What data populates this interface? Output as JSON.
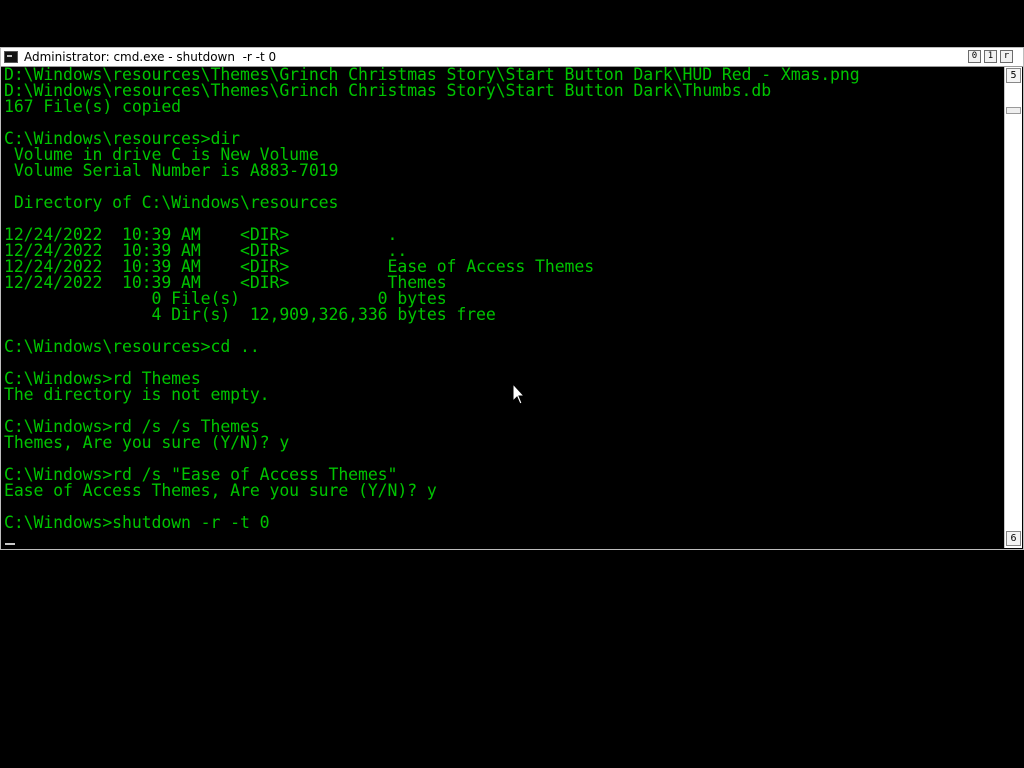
{
  "window": {
    "title": "Administrator: cmd.exe - shutdown  -r -t 0",
    "controls": {
      "minimize": "0",
      "maximize": "1",
      "close": "r"
    }
  },
  "terminal": {
    "lines": [
      "D:\\Windows\\resources\\Themes\\Grinch Christmas Story\\Start Button Dark\\HUD Red - Xmas.png",
      "D:\\Windows\\resources\\Themes\\Grinch Christmas Story\\Start Button Dark\\Thumbs.db",
      "167 File(s) copied",
      "",
      "C:\\Windows\\resources>dir",
      " Volume in drive C is New Volume",
      " Volume Serial Number is A883-7019",
      "",
      " Directory of C:\\Windows\\resources",
      "",
      "12/24/2022  10:39 AM    <DIR>          .",
      "12/24/2022  10:39 AM    <DIR>          ..",
      "12/24/2022  10:39 AM    <DIR>          Ease of Access Themes",
      "12/24/2022  10:39 AM    <DIR>          Themes",
      "               0 File(s)              0 bytes",
      "               4 Dir(s)  12,909,326,336 bytes free",
      "",
      "C:\\Windows\\resources>cd ..",
      "",
      "C:\\Windows>rd Themes",
      "The directory is not empty.",
      "",
      "C:\\Windows>rd /s /s Themes",
      "Themes, Are you sure (Y/N)? y",
      "",
      "C:\\Windows>rd /s \"Ease of Access Themes\"",
      "Ease of Access Themes, Are you sure (Y/N)? y",
      "",
      "C:\\Windows>shutdown -r -t 0"
    ]
  },
  "scrollbar": {
    "up_glyph": "5",
    "down_glyph": "6"
  },
  "icons": {
    "window_icon": "console-icon",
    "mouse_pointer": "mouse-pointer-icon"
  },
  "colors": {
    "terminal_text": "#00c400",
    "terminal_background": "#000000",
    "titlebar": "#ffffff"
  }
}
